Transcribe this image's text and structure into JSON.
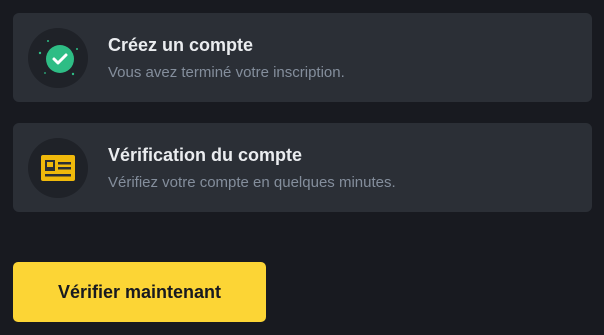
{
  "steps": [
    {
      "title": "Créez un compte",
      "description": "Vous avez terminé votre inscription.",
      "icon": "check-circle-icon",
      "status": "completed"
    },
    {
      "title": "Vérification du compte",
      "description": "Vérifiez votre compte en quelques minutes.",
      "icon": "id-card-icon",
      "status": "pending"
    }
  ],
  "cta": {
    "label": "Vérifier maintenant"
  },
  "colors": {
    "background": "#181a20",
    "card": "#2b2f36",
    "accent_green": "#2ebd85",
    "accent_yellow": "#fcd535",
    "text_primary": "#eaecef",
    "text_secondary": "#848e9c"
  }
}
